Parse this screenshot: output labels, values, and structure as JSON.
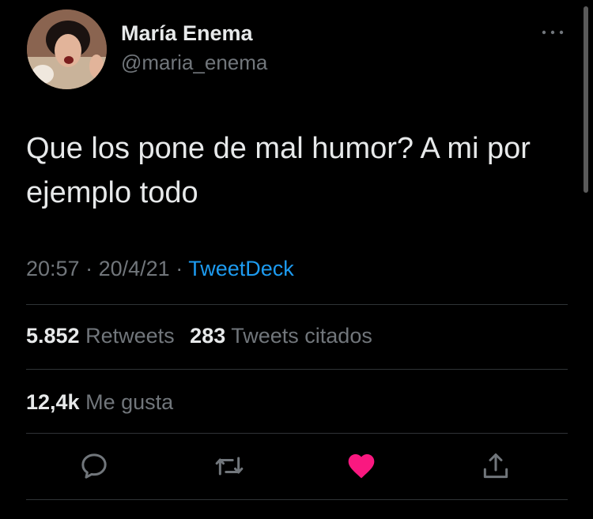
{
  "author": {
    "display_name": "María Enema",
    "handle": "@maria_enema"
  },
  "tweet": {
    "text": "Que los pone de mal humor? A mi por ejemplo todo",
    "time": "20:57",
    "separator": "·",
    "date": "20/4/21",
    "source": "TweetDeck"
  },
  "stats": {
    "retweets_count": "5.852",
    "retweets_label": "Retweets",
    "quotes_count": "283",
    "quotes_label": "Tweets citados",
    "likes_count": "12,4k",
    "likes_label": "Me gusta"
  },
  "actions": {
    "reply_icon": "reply-icon",
    "retweet_icon": "retweet-icon",
    "like_icon": "heart-icon",
    "share_icon": "share-icon",
    "liked": true
  },
  "colors": {
    "background": "#000000",
    "primary_text": "#e7e9ea",
    "secondary_text": "#71767b",
    "link": "#1d9bf0",
    "like": "#f91880",
    "divider": "#2f3336"
  }
}
